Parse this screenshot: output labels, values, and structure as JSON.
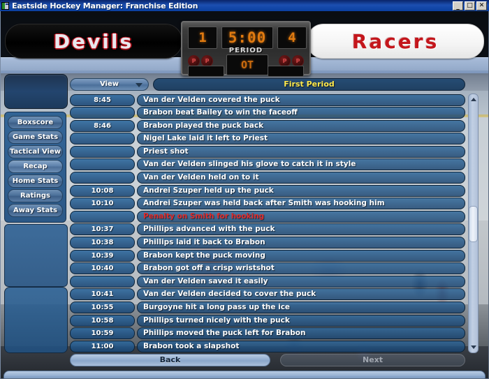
{
  "window": {
    "title": "Eastside Hockey Manager: Franchise Edition",
    "icon": "app-icon",
    "minimize_label": "_",
    "maximize_label": "□",
    "close_label": "✕"
  },
  "scoreboard": {
    "home_score": "1",
    "clock": "5:00",
    "away_score": "4",
    "period_label": "PERIOD",
    "overtime_label": "OT",
    "penalty_lights": [
      "P",
      "P",
      "P",
      "P"
    ]
  },
  "teams": {
    "home": "Devils",
    "away": "Racers"
  },
  "sidebar": {
    "items": [
      {
        "label": "Boxscore",
        "selected": false
      },
      {
        "label": "Game Stats",
        "selected": false
      },
      {
        "label": "Tactical View",
        "selected": false
      },
      {
        "label": "Recap",
        "selected": true
      },
      {
        "label": "Home Stats",
        "selected": false
      },
      {
        "label": "Ratings",
        "selected": false
      },
      {
        "label": "Away Stats",
        "selected": false
      }
    ]
  },
  "toolbar": {
    "view_label": "View",
    "period_header": "First Period"
  },
  "events": [
    {
      "time": "8:45",
      "text": "Van der Velden covered the puck",
      "penalty": false
    },
    {
      "time": "",
      "text": "Brabon beat Bailey to win the faceoff",
      "penalty": false
    },
    {
      "time": "8:46",
      "text": "Brabon played the puck back",
      "penalty": false
    },
    {
      "time": "",
      "text": "Nigel Lake laid it left to Priest",
      "penalty": false
    },
    {
      "time": "",
      "text": "Priest shot",
      "penalty": false
    },
    {
      "time": "",
      "text": "Van der Velden slinged his glove to catch it in style",
      "penalty": false
    },
    {
      "time": "",
      "text": "Van der Velden held on to it",
      "penalty": false
    },
    {
      "time": "10:08",
      "text": "Andrei Szuper held up the puck",
      "penalty": false
    },
    {
      "time": "10:10",
      "text": "Andrei Szuper was held back after Smith was hooking him",
      "penalty": false
    },
    {
      "time": "",
      "text": "Penalty on Smith for hooking",
      "penalty": true
    },
    {
      "time": "10:37",
      "text": "Phillips advanced with the puck",
      "penalty": false
    },
    {
      "time": "10:38",
      "text": "Phillips laid it back to Brabon",
      "penalty": false
    },
    {
      "time": "10:39",
      "text": "Brabon kept the puck moving",
      "penalty": false
    },
    {
      "time": "10:40",
      "text": "Brabon got off a crisp wristshot",
      "penalty": false
    },
    {
      "time": "",
      "text": "Van der Velden saved it easily",
      "penalty": false
    },
    {
      "time": "10:41",
      "text": "Van der Velden decided to cover the puck",
      "penalty": false
    },
    {
      "time": "10:55",
      "text": "Burgoyne hit a long pass up the ice",
      "penalty": false
    },
    {
      "time": "10:58",
      "text": "Phillips turned nicely with the puck",
      "penalty": false
    },
    {
      "time": "10:59",
      "text": "Phillips moved the puck left for Brabon",
      "penalty": false
    },
    {
      "time": "11:00",
      "text": "Brabon took a slapshot",
      "penalty": false
    }
  ],
  "footer": {
    "back_label": "Back",
    "next_label": "Next"
  },
  "colors": {
    "penalty_text": "#e02b2b",
    "period_header_text": "#ffe94d",
    "scoreboard_digits": "#e07a10",
    "home_banner_bg": "#000000",
    "away_banner_bg": "#ffffff",
    "away_team_text": "#c4161c"
  }
}
